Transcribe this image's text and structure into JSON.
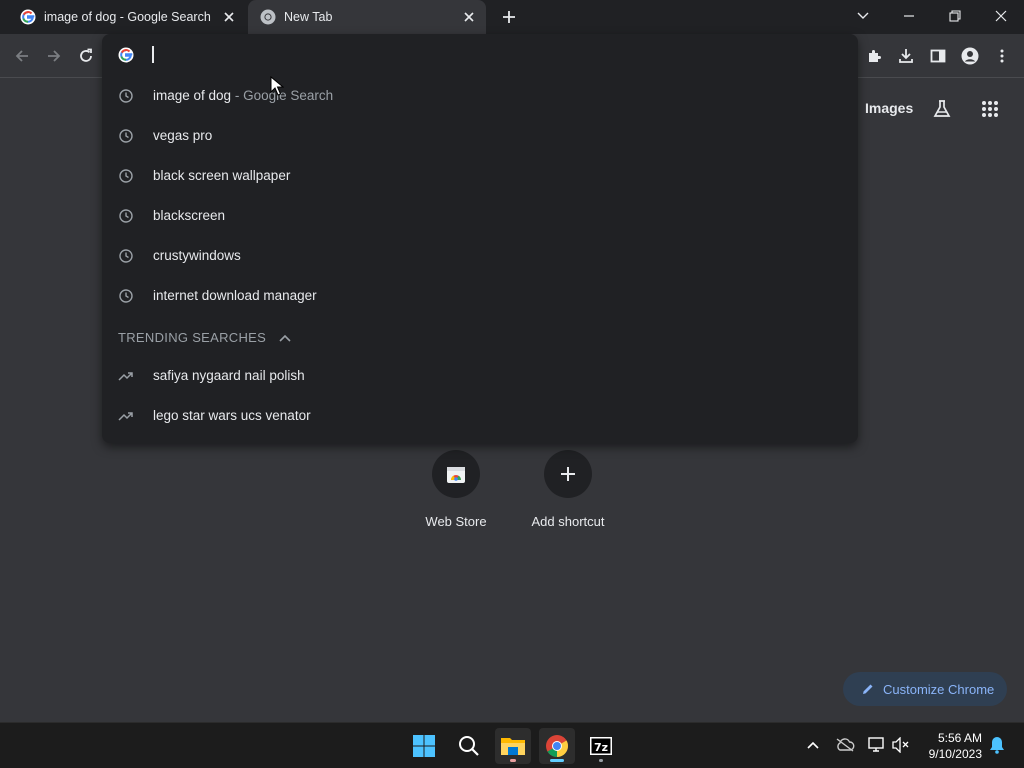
{
  "tabs": [
    {
      "title": "image of dog - Google Search",
      "favicon": "google-g-icon",
      "active": false
    },
    {
      "title": "New Tab",
      "favicon": "chrome-icon",
      "active": true
    }
  ],
  "omnibox": {
    "value": "",
    "favicon": "google-g-icon"
  },
  "suggestions": [
    {
      "icon": "history-clock-icon",
      "text": "image of dog",
      "sub": "- Google Search"
    },
    {
      "icon": "history-clock-icon",
      "text": "vegas pro",
      "sub": ""
    },
    {
      "icon": "history-clock-icon",
      "text": "black screen wallpaper",
      "sub": ""
    },
    {
      "icon": "history-clock-icon",
      "text": "blackscreen",
      "sub": ""
    },
    {
      "icon": "history-clock-icon",
      "text": "crustywindows",
      "sub": ""
    },
    {
      "icon": "history-clock-icon",
      "text": "internet download manager",
      "sub": ""
    }
  ],
  "trending": {
    "header": "TRENDING SEARCHES",
    "items": [
      {
        "icon": "trending-arrow-icon",
        "text": "safiya nygaard nail polish"
      },
      {
        "icon": "trending-arrow-icon",
        "text": "lego star wars ucs venator"
      }
    ]
  },
  "ntp": {
    "images_link": "Images",
    "shortcuts": [
      {
        "label": "Web Store",
        "icon": "web-store-icon"
      },
      {
        "label": "Add shortcut",
        "icon": "plus-icon"
      }
    ],
    "customize_label": "Customize Chrome"
  },
  "taskbar": {
    "time": "5:56 AM",
    "date": "9/10/2023",
    "apps": [
      "windows-start-icon",
      "search-icon",
      "file-explorer-icon",
      "chrome-icon",
      "7zip-icon"
    ]
  },
  "colors": {
    "page_bg": "#35363a",
    "frame_bg": "#202124",
    "accent_blue": "#8ab4f8",
    "taskbar_bg": "#1c1c1c"
  }
}
